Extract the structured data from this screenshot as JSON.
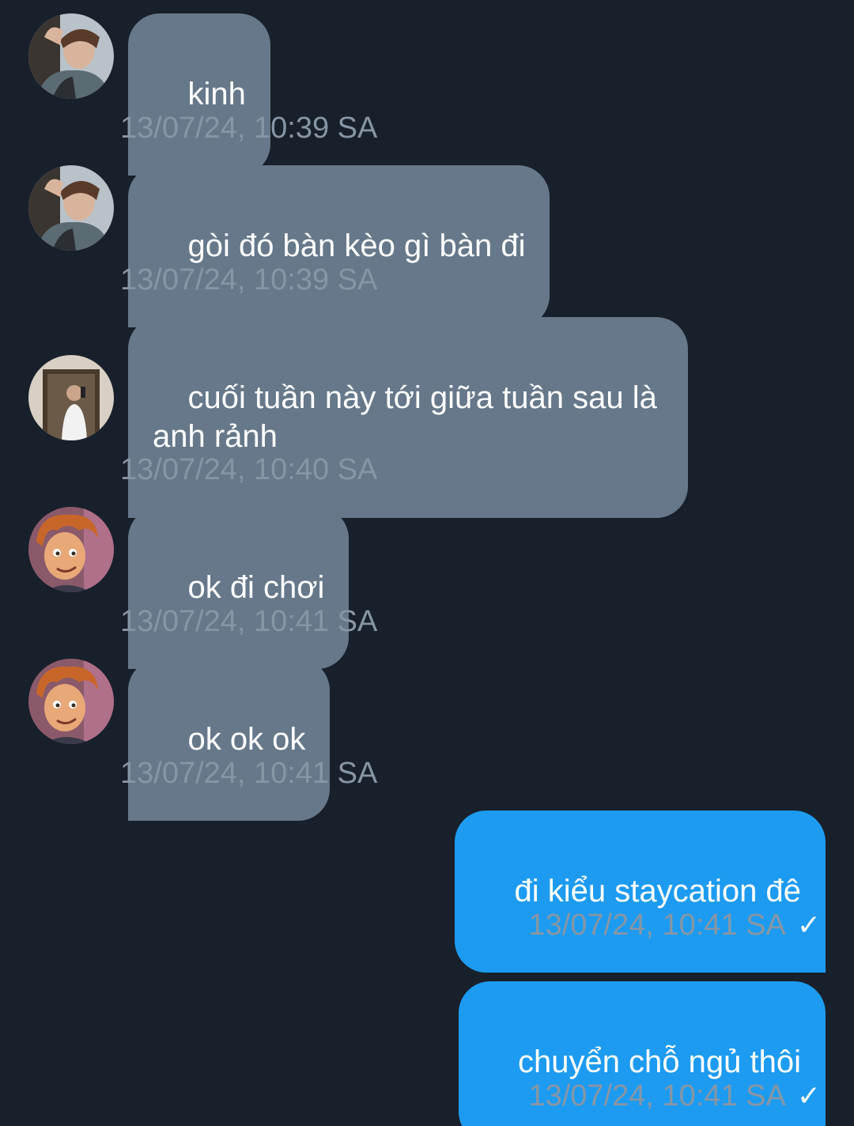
{
  "conversation": {
    "messages": [
      {
        "direction": "incoming",
        "avatar": "avatar-user-hood",
        "text": "kinh",
        "time": "13/07/24, 10:39 SA"
      },
      {
        "direction": "incoming",
        "avatar": "avatar-user-hood",
        "text": "gòi đó bàn kèo gì bàn đi",
        "time": "13/07/24, 10:39 SA"
      },
      {
        "direction": "incoming",
        "avatar": "avatar-user-mirror-selfie",
        "text": "cuối tuần này tới giữa tuần sau là anh rảnh",
        "time": "13/07/24, 10:40 SA"
      },
      {
        "direction": "incoming",
        "avatar": "avatar-user-cartoon",
        "text": "ok đi chơi",
        "time": "13/07/24, 10:41 SA"
      },
      {
        "direction": "incoming",
        "avatar": "avatar-user-cartoon",
        "text": "ok ok ok",
        "time": "13/07/24, 10:41 SA"
      },
      {
        "direction": "outgoing",
        "text": "đi kiểu staycation đê",
        "time": "13/07/24, 10:41 SA",
        "status_icon": "check-icon"
      },
      {
        "direction": "outgoing",
        "text": "chuyển chỗ ngủ thôi",
        "time": "13/07/24, 10:41 SA",
        "status_icon": "check-icon"
      }
    ]
  },
  "colors": {
    "background": "#18202b",
    "incoming_bubble": "#66788a",
    "outgoing_bubble": "#1d9bf0",
    "timestamp": "#8796a5",
    "text": "#ffffff"
  },
  "icons": {
    "check": "✓"
  }
}
